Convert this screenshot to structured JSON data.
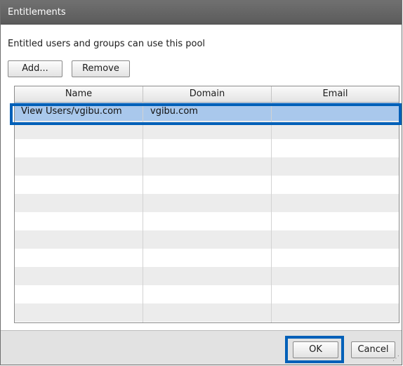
{
  "dialog": {
    "title": "Entitlements",
    "description": "Entitled users and groups can use this pool"
  },
  "toolbar": {
    "add_label": "Add...",
    "remove_label": "Remove"
  },
  "table": {
    "columns": [
      "Name",
      "Domain",
      "Email"
    ],
    "rows": [
      {
        "name": "View Users/vgibu.com",
        "domain": "vgibu.com",
        "email": ""
      }
    ]
  },
  "footer": {
    "ok_label": "OK",
    "cancel_label": "Cancel"
  },
  "colors": {
    "title_bar": "#5f5f5f",
    "selected_row": "#a9c8ec",
    "highlight_outline": "#0060b8",
    "alternate_row": "#ececec",
    "footer_background": "#e2e2e2"
  }
}
